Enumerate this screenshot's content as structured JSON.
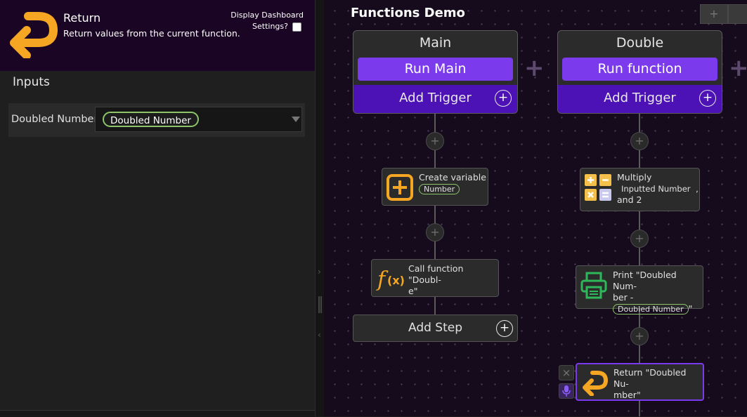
{
  "block": {
    "title": "Return",
    "description": "Return values from the current function.",
    "dashboard_label_line1": "Display Dashboard",
    "dashboard_label_line2": "Settings?"
  },
  "inputs": {
    "heading": "Inputs",
    "rows": [
      {
        "label": "Doubled Number",
        "value": "Doubled Number"
      }
    ]
  },
  "canvas": {
    "title": "Functions Demo",
    "zoom_in": "+"
  },
  "functions": [
    {
      "name": "Main",
      "run_label": "Run Main",
      "trigger_label": "Add Trigger",
      "steps": [
        {
          "text": "Create variable",
          "chip": "Number",
          "icon": "add-box-icon"
        },
        {
          "text": "Call function \"Doubl-e\"",
          "line1": "Call function \"Doubl-",
          "line2": "e\"",
          "icon": "function-icon"
        }
      ],
      "add_step_label": "Add Step"
    },
    {
      "name": "Double",
      "run_label": "Run function",
      "trigger_label": "Add Trigger",
      "steps": [
        {
          "line1": "Multiply",
          "chip": "Inputted Number",
          "after_chip": ",",
          "line3": "and 2",
          "icon": "calculator-icon"
        },
        {
          "line1": "Print \"Doubled Num-",
          "line2": "ber -",
          "chip": "Doubled Number",
          "after_chip": "\"",
          "icon": "printer-icon"
        },
        {
          "line1": "Return \"Doubled Nu-",
          "line2": "mber\"",
          "icon": "return-icon",
          "selected": true
        }
      ]
    }
  ],
  "colors": {
    "accent_purple": "#7c3aed",
    "trigger_purple": "#4c12b5",
    "chip_green": "#8dc46a",
    "return_orange": "#f5a623",
    "selected_border": "#7c3aed"
  }
}
